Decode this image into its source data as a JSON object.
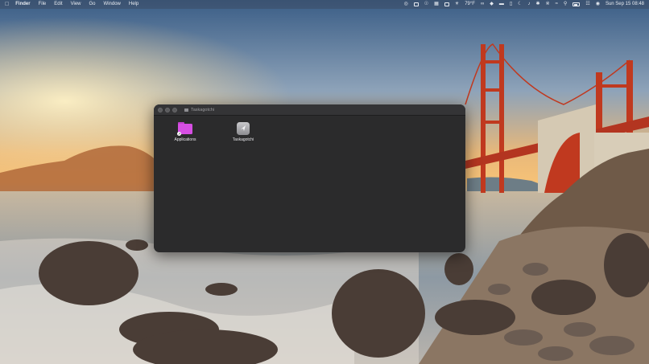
{
  "menubar": {
    "apple_icon": "apple-icon",
    "items": [
      "Finder",
      "File",
      "Edit",
      "View",
      "Go",
      "Window",
      "Help"
    ],
    "weather": "79°F",
    "datetime": "Sun Sep 15  08:48"
  },
  "window": {
    "title": "Taskagotchi",
    "title_icon": "folder-icon",
    "files": [
      {
        "label": "Applications",
        "icon": "folder-alias-icon",
        "color": "#d64fe3"
      },
      {
        "label": "Taskagotchi",
        "icon": "app-icon"
      }
    ]
  },
  "wallpaper": {
    "description_icon": "golden-gate-bridge-wallpaper",
    "bridge_color": "#c0391f"
  }
}
